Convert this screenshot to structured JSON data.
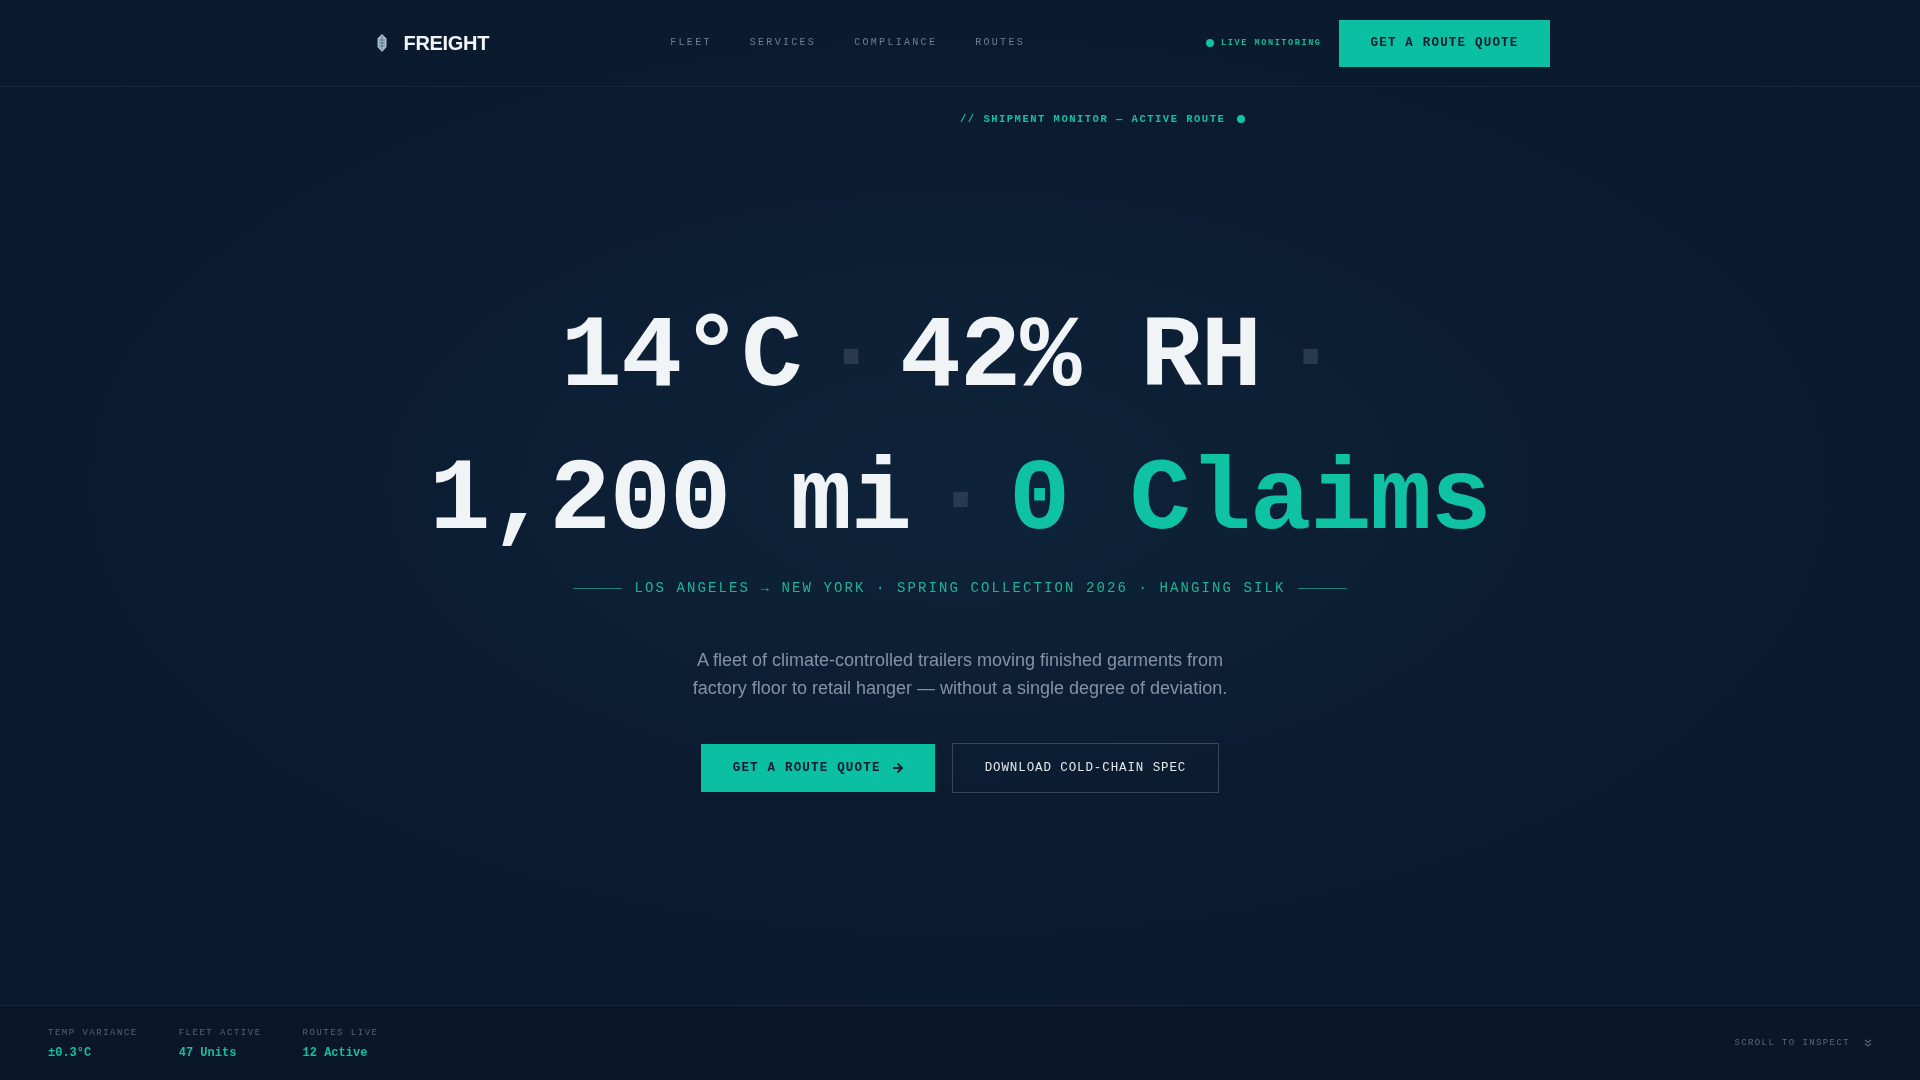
{
  "header": {
    "logo": {
      "text": "FREIGHT"
    },
    "nav": [
      {
        "label": "FLEET"
      },
      {
        "label": "SERVICES"
      },
      {
        "label": "COMPLIANCE"
      },
      {
        "label": "ROUTES"
      }
    ],
    "status": {
      "label": "LIVE MONITORING",
      "live": true
    },
    "cta": {
      "label": "GET A ROUTE QUOTE"
    }
  },
  "hero": {
    "eyebrow": {
      "text": "// SHIPMENT MONITOR — ACTIVE ROUTE",
      "live": true
    },
    "headline": {
      "lines": [
        [
          {
            "text": "14°C",
            "kind": "value"
          },
          {
            "text": "·",
            "kind": "separator"
          },
          {
            "text": "42% RH",
            "kind": "value"
          },
          {
            "text": "·",
            "kind": "separator"
          }
        ],
        [
          {
            "text": "1,200 mi",
            "kind": "value"
          },
          {
            "text": "·",
            "kind": "separator"
          },
          {
            "text": "0 Claims",
            "kind": "accent"
          }
        ]
      ]
    },
    "route_line": "LOS ANGELES → NEW YORK · SPRING COLLECTION 2026 · HANGING SILK",
    "description": "A fleet of climate-controlled trailers moving finished garments from factory floor to retail hanger — without a single degree of deviation.",
    "buttons": [
      {
        "label": "GET A ROUTE QUOTE",
        "kind": "primary"
      },
      {
        "label": "DOWNLOAD COLD-CHAIN SPEC",
        "kind": "secondary"
      }
    ]
  },
  "stats_bar": {
    "stats": [
      {
        "label": "TEMP VARIANCE",
        "value": "±0.3°C"
      },
      {
        "label": "FLEET ACTIVE",
        "value": "47 Units"
      },
      {
        "label": "ROUTES LIVE",
        "value": "12 Active"
      }
    ],
    "scroll_hint": "SCROLL TO INSPECT"
  }
}
